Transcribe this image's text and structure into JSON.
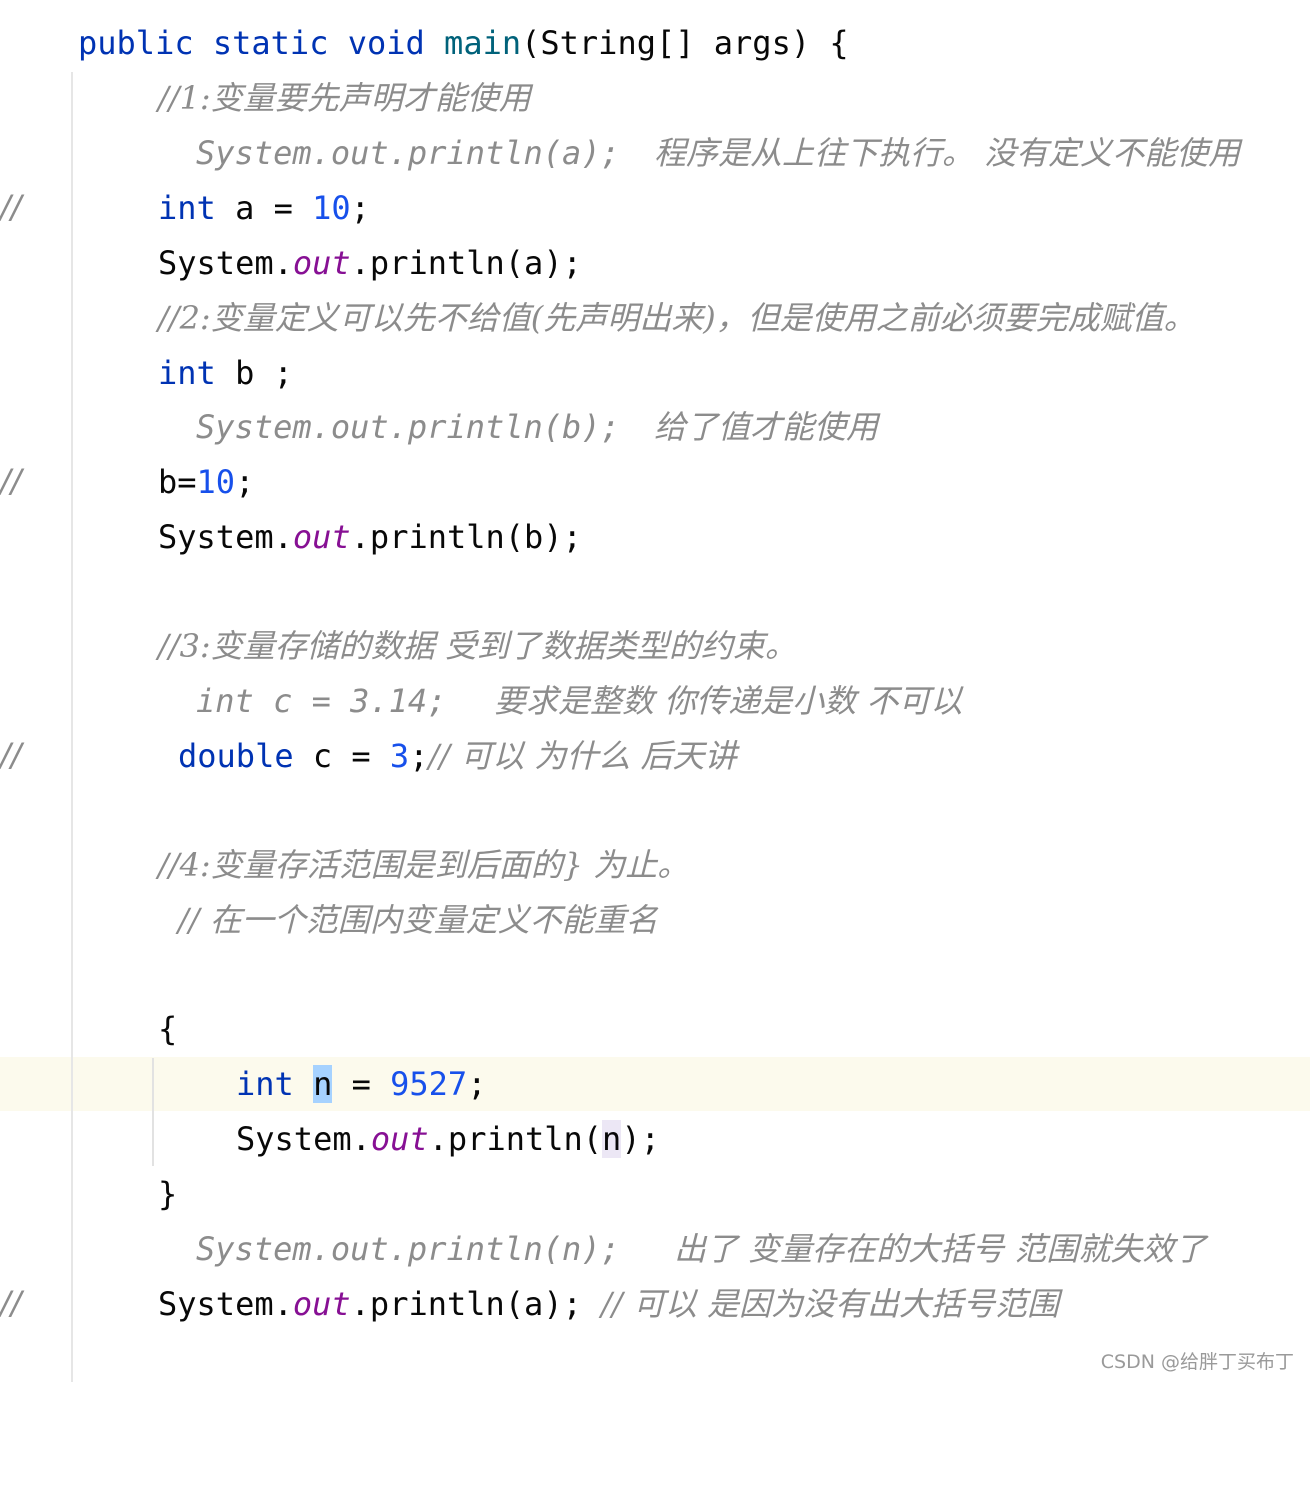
{
  "editor": {
    "line1": {
      "kw1": "public",
      "kw2": "static",
      "kw3": "void",
      "method": "main",
      "rest": "(String[] args) {"
    },
    "c1": "//1:变量要先声明才能使用",
    "c2": {
      "gutter": "//",
      "code": "System.out.println(a);",
      "text": "程序是从上往下执行。 没有定义不能使用"
    },
    "line4": {
      "kw": "int",
      "mid": " a = ",
      "num": "10",
      "end": ";"
    },
    "line5": {
      "cls": "System.",
      "fld": "out",
      "end": ".println(a);"
    },
    "c3": "//2:变量定义可以先不给值(先声明出来)，但是使用之前必须要完成赋值。",
    "line7": {
      "kw": "int",
      "end": " b ;"
    },
    "c4": {
      "gutter": "//",
      "code": "System.out.println(b);",
      "text": "给了值才能使用"
    },
    "line9": {
      "start": "b=",
      "num": "10",
      "end": ";"
    },
    "line10": {
      "cls": "System.",
      "fld": "out",
      "end": ".println(b);"
    },
    "c5": "//3:变量存储的数据 受到了数据类型的约束。",
    "c6": {
      "gutter": "//",
      "code": "int c = 3.14;",
      "text": "要求是整数 你传递是小数 不可以"
    },
    "line13": {
      "kw": "double",
      "mid": " c = ",
      "num": "3",
      "end": ";",
      "comment": "// 可以 为什么 后天讲"
    },
    "c7": "//4:变量存活范围是到后面的} 为止。",
    "c8": "// 在一个范围内变量定义不能重名",
    "brace_open": "{",
    "line17": {
      "kw": "int",
      "var": "n",
      "mid": " = ",
      "num": "9527",
      "end": ";"
    },
    "line18": {
      "cls": "System.",
      "fld": "out",
      "mid": ".println(",
      "var": "n",
      "end": ");"
    },
    "brace_close": "}",
    "c9": {
      "gutter": "//",
      "code": "System.out.println(n);",
      "text": "出了 变量存在的大括号 范围就失效了"
    },
    "line21": {
      "cls": "System.",
      "fld": "out",
      "end": ".println(a);",
      "comment": "// 可以 是因为没有出大括号范围"
    }
  },
  "watermark": "CSDN @给胖丁买布丁"
}
